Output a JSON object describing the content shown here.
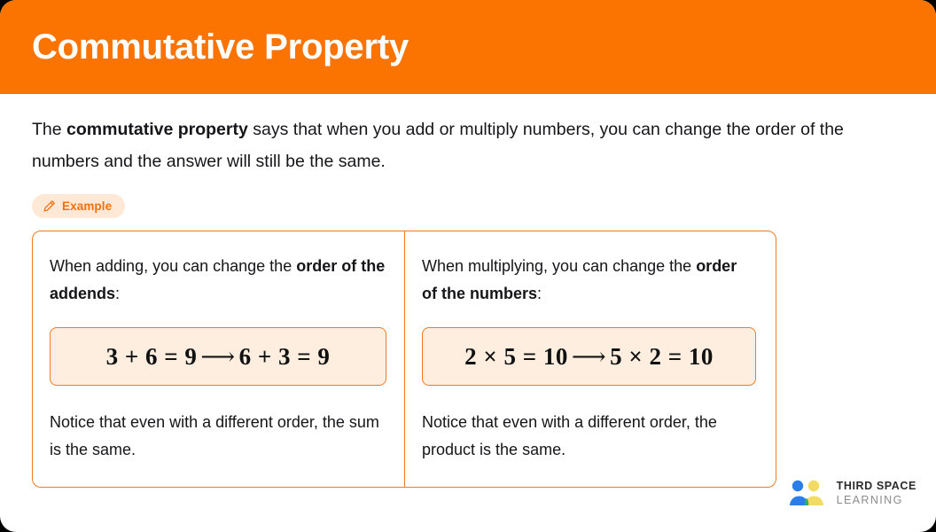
{
  "header": {
    "title": "Commutative Property",
    "background_color": "#fb7300",
    "text_color": "#ffffff"
  },
  "intro": {
    "part1": "The ",
    "bold": "commutative property",
    "part2": " says that when you add or multiply numbers, you can change the order of the numbers and the answer will still be the same."
  },
  "example_badge": {
    "icon": "pencil-icon",
    "label": "Example",
    "text_color": "#f2700d",
    "background_color": "#ffe9d6"
  },
  "example_box": {
    "border_color": "#f47a1f",
    "columns": [
      {
        "lead_part1": "When adding, you can change the ",
        "lead_bold": "order of the addends",
        "lead_part2": ":",
        "equation_left": "3 + 6 = 9",
        "equation_arrow": "⟶",
        "equation_right": "6 + 3 = 9",
        "note": "Notice that even with a different order, the sum is the same."
      },
      {
        "lead_part1": "When multiplying, you can change the ",
        "lead_bold": "order of the numbers",
        "lead_part2": ":",
        "equation_left": "2 × 5 = 10",
        "equation_arrow": "⟶",
        "equation_right": "5 × 2 = 10",
        "note": "Notice that even with a different order, the product is the same."
      }
    ],
    "equation_background_color": "#fdeee0"
  },
  "logo": {
    "name_top": "THIRD SPACE",
    "name_bottom": "LEARNING",
    "colors": {
      "blue": "#2b7de9",
      "yellow": "#f2db63",
      "green": "#2fae72"
    }
  }
}
